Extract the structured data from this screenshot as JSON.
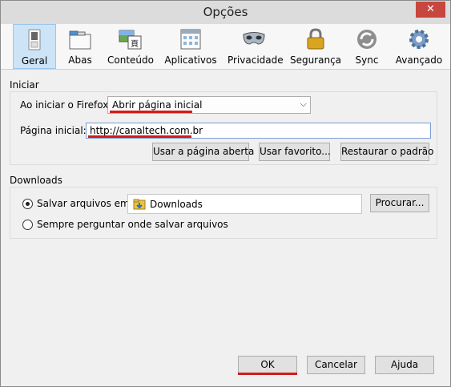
{
  "window": {
    "title": "Opções",
    "close_label": "✕"
  },
  "toolbar": {
    "items": [
      {
        "label": "Geral",
        "icon": "switch-icon",
        "selected": true
      },
      {
        "label": "Abas",
        "icon": "tabs-icon"
      },
      {
        "label": "Conteúdo",
        "icon": "content-icon"
      },
      {
        "label": "Aplicativos",
        "icon": "applications-icon"
      },
      {
        "label": "Privacidade",
        "icon": "mask-icon"
      },
      {
        "label": "Segurança",
        "icon": "padlock-icon"
      },
      {
        "label": "Sync",
        "icon": "sync-icon"
      },
      {
        "label": "Avançado",
        "icon": "gear-icon"
      }
    ]
  },
  "startup": {
    "group_title": "Iniciar",
    "when_start_label": "Ao iniciar o Firefox:",
    "when_start_value": "Abrir página inicial",
    "homepage_label": "Página inicial:",
    "homepage_value": "http://canaltech.com.br",
    "use_current_label": "Usar a página aberta",
    "use_bookmark_label": "Usar favorito...",
    "restore_default_label": "Restaurar o padrão"
  },
  "downloads": {
    "group_title": "Downloads",
    "save_to_label": "Salvar arquivos em:",
    "folder_name": "Downloads",
    "browse_label": "Procurar...",
    "always_ask_label": "Sempre perguntar onde salvar arquivos"
  },
  "footer": {
    "ok_label": "OK",
    "cancel_label": "Cancelar",
    "help_label": "Ajuda"
  },
  "colors": {
    "highlight_red": "#d21b1b",
    "selected_tab": "#cde4f7",
    "close_red": "#c7463e"
  }
}
